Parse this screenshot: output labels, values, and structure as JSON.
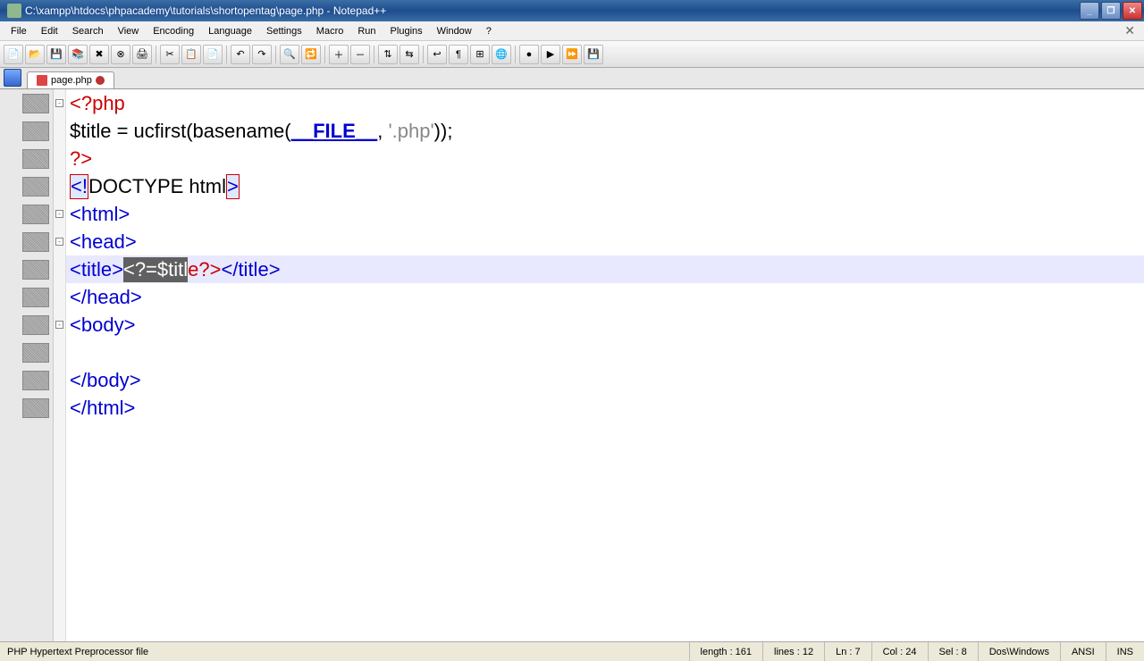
{
  "window": {
    "title": "C:\\xampp\\htdocs\\phpacademy\\tutorials\\shortopentag\\page.php - Notepad++"
  },
  "menu": {
    "file": "File",
    "edit": "Edit",
    "search": "Search",
    "view": "View",
    "encoding": "Encoding",
    "language": "Language",
    "settings": "Settings",
    "macro": "Macro",
    "run": "Run",
    "plugins": "Plugins",
    "window": "Window",
    "help": "?"
  },
  "tab": {
    "filename": "page.php"
  },
  "code": {
    "l1_open": "<?php",
    "l2_a": "$title = ucfirst(basename(",
    "l2_magic": "__FILE__",
    "l2_b": ", ",
    "l2_str": "'.php'",
    "l2_c": "));",
    "l3": "?>",
    "l4_a": "<!",
    "l4_b": "DOCTYPE html",
    "l4_c": ">",
    "l5_o": "<",
    "l5_t": "html",
    "l5_c": ">",
    "l6_o": "<",
    "l6_t": "head",
    "l6_c": ">",
    "l7_o": "<",
    "l7_t": "title",
    "l7_c": ">",
    "l7_sel": "<?=$titl",
    "l7_rem": "e?>",
    "l7_co": "</",
    "l7_ct": "title",
    "l7_cc": ">",
    "l8_o": "</",
    "l8_t": "head",
    "l8_c": ">",
    "l9_o": "<",
    "l9_t": "body",
    "l9_c": ">",
    "l10": "",
    "l11_o": "</",
    "l11_t": "body",
    "l11_c": ">",
    "l12_o": "</",
    "l12_t": "html",
    "l12_c": ">"
  },
  "status": {
    "filetype": "PHP Hypertext Preprocessor file",
    "length": "length : 161",
    "lines": "lines : 12",
    "ln": "Ln : 7",
    "col": "Col : 24",
    "sel": "Sel : 8",
    "eol": "Dos\\Windows",
    "enc": "ANSI",
    "ins": "INS"
  }
}
